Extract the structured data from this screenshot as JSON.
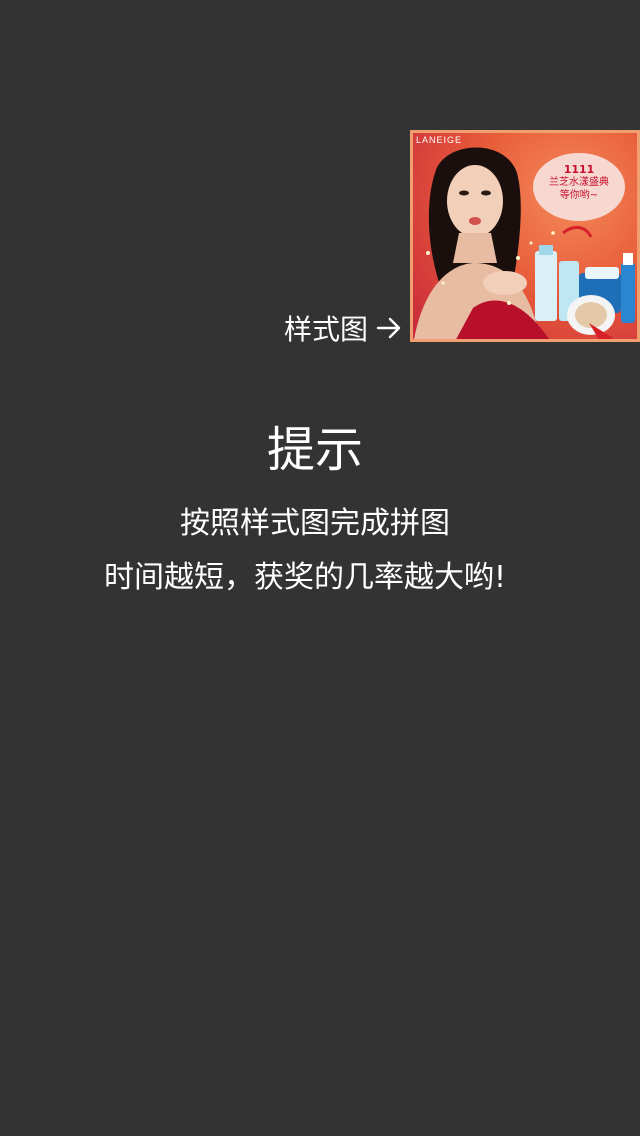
{
  "sample": {
    "label": "样式图",
    "arrow_icon": "arrow-right-icon",
    "image": {
      "brand": "LANEIGE",
      "promo_event": "1111",
      "promo_lines": [
        "兰芝水漾盛典",
        "等你哟~"
      ],
      "border_color": "#f0a070"
    }
  },
  "hint": {
    "title": "提示",
    "line1": "按照样式图完成拼图",
    "line2": "时间越短，获奖的几率越大哟!"
  },
  "colors": {
    "background": "#333333",
    "text": "#ffffff"
  }
}
